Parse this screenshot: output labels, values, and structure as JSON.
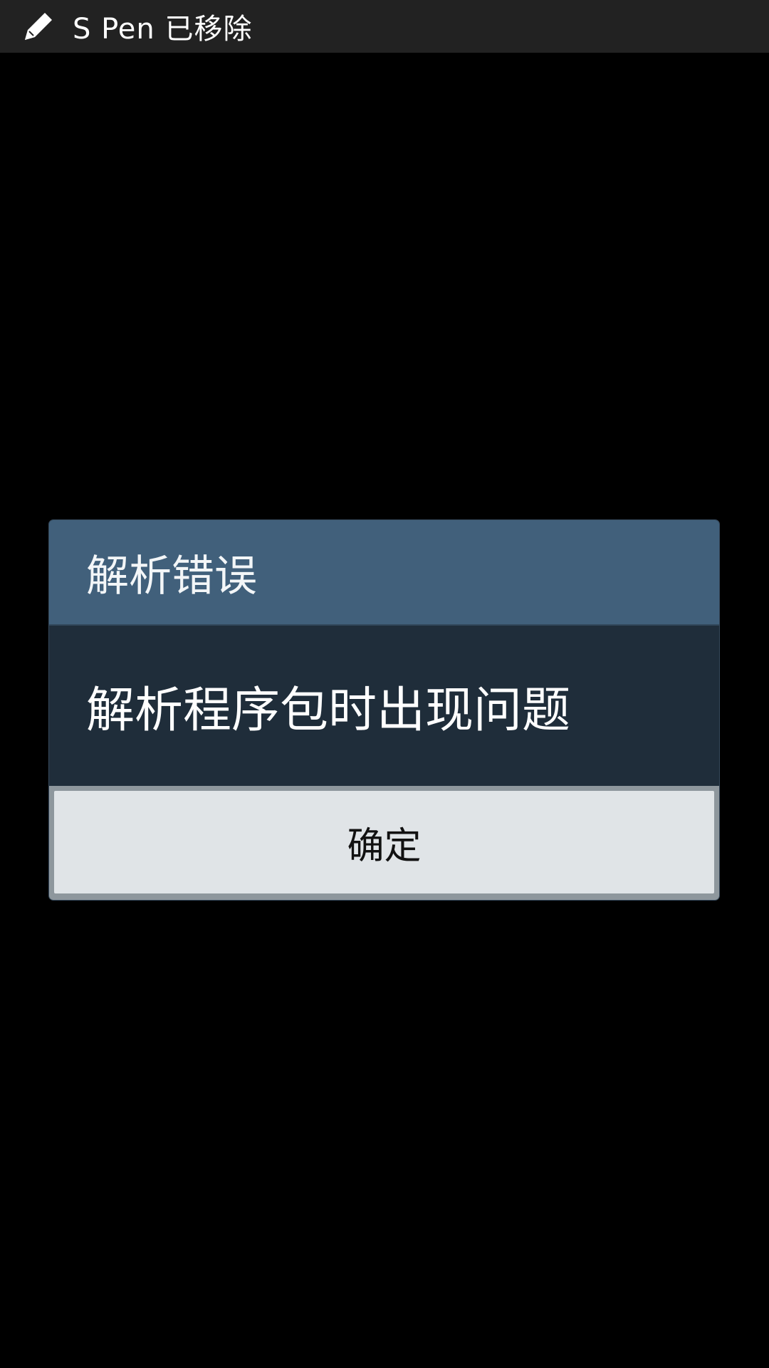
{
  "status_bar": {
    "icon": "pen-icon",
    "text": "S Pen 已移除",
    "background": "#222222"
  },
  "dialog": {
    "title": "解析错误",
    "message": "解析程序包时出现问题",
    "ok_label": "确定",
    "colors": {
      "title_bar": "#41607b",
      "body": "#1f2d3a",
      "button": "#e0e4e7"
    }
  }
}
